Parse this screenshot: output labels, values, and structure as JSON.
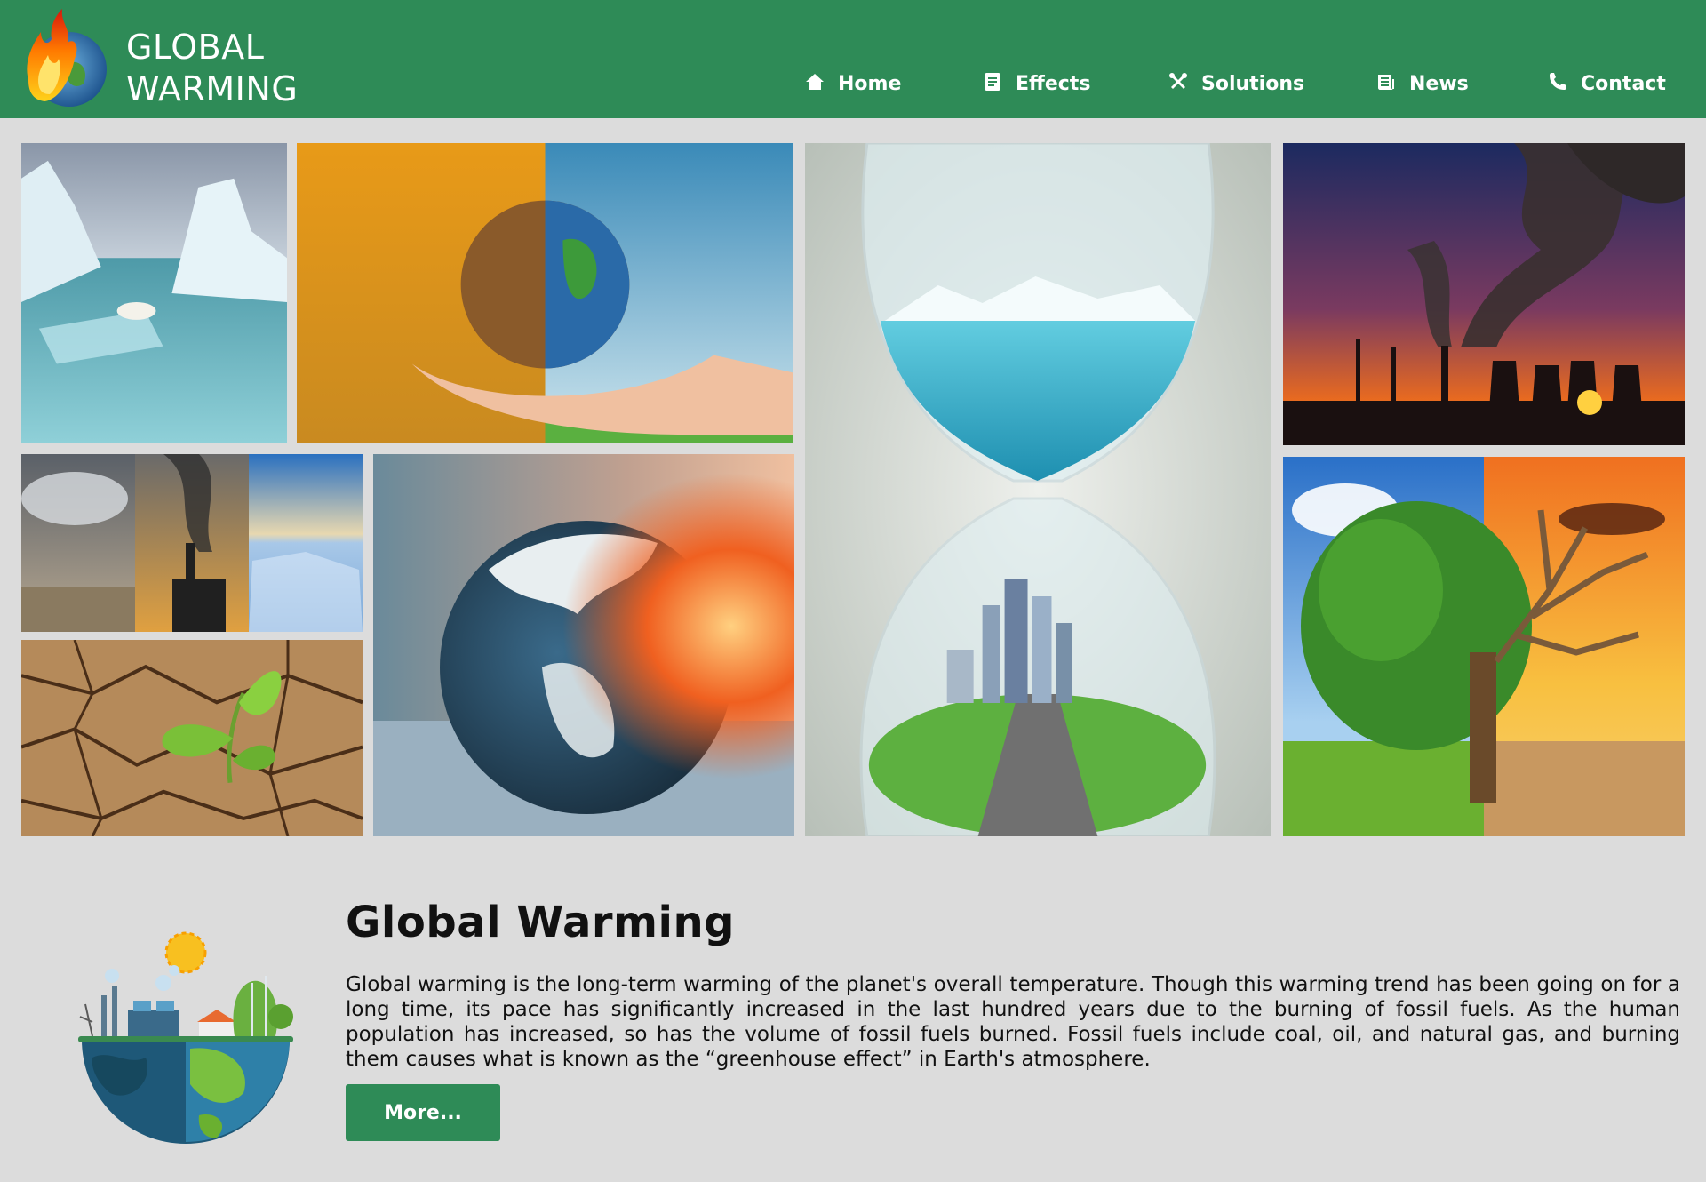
{
  "header": {
    "logo_line1": "GLOBAL",
    "logo_line2": "WARMING",
    "logo_icon": "burning-earth-icon",
    "bg_color": "#2e8b57"
  },
  "nav": {
    "items": [
      {
        "label": "Home",
        "icon": "home-icon"
      },
      {
        "label": "Effects",
        "icon": "document-icon"
      },
      {
        "label": "Solutions",
        "icon": "tools-icon"
      },
      {
        "label": "News",
        "icon": "newspaper-icon"
      },
      {
        "label": "Contact",
        "icon": "phone-icon"
      }
    ]
  },
  "gallery": {
    "images": [
      "polar-bear-iceberg",
      "earth-burning-vs-green-in-hands",
      "hourglass-melting-ice-city",
      "factory-smoke-sunset",
      "storm-pollution-ice-collage",
      "burning-frozen-earth",
      "sprout-cracked-earth",
      "green-vs-dead-tree"
    ]
  },
  "about": {
    "title": "Global Warming",
    "text": "Global warming is the long-term warming of the planet's overall temperature. Though this warming trend has been going on for a long time, its pace has significantly increased in the last hundred years due to the burning of fossil fuels. As the human population has increased, so has the volume of fossil fuels burned. Fossil fuels include coal, oil, and natural gas, and burning them causes what is known as the “greenhouse effect” in Earth's atmosphere.",
    "button_label": "More...",
    "illustration": "earth-pollution-vs-green-illustration"
  },
  "colors": {
    "accent": "#2e8b57",
    "background": "#dcdcdc",
    "text": "#111111"
  }
}
